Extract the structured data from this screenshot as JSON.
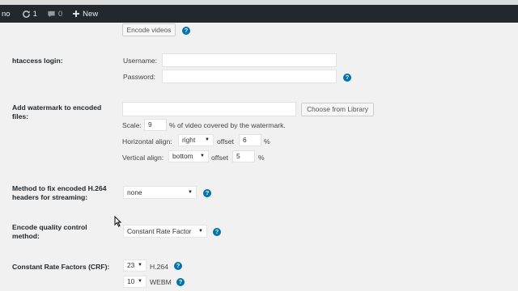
{
  "adminbar": {
    "site_label": "no",
    "updates_count": "1",
    "comments_count": "0",
    "new_label": "New"
  },
  "encode_section": {
    "button_label": "Encode videos"
  },
  "htaccess": {
    "label": "htaccess login:",
    "username_label": "Username:",
    "password_label": "Password:"
  },
  "watermark": {
    "label": "Add watermark to encoded files:",
    "choose_button": "Choose from Library",
    "scale_label": "Scale:",
    "scale_value": "9",
    "scale_suffix": "% of video covered by the watermark.",
    "h_align_label": "Horizontal align:",
    "h_align_value": "right",
    "h_offset_label": "offset",
    "h_offset_value": "6",
    "h_offset_unit": "%",
    "v_align_label": "Vertical align:",
    "v_align_value": "bottom",
    "v_offset_label": "offset",
    "v_offset_value": "5",
    "v_offset_unit": "%"
  },
  "h264_fix": {
    "label": "Method to fix encoded H.264 headers for streaming:",
    "value": "none"
  },
  "quality": {
    "label": "Encode quality control method:",
    "value": "Constant Rate Factor"
  },
  "crf": {
    "label": "Constant Rate Factors (CRF):",
    "h264_value": "23",
    "h264_label": "H.264",
    "webm_value": "10",
    "webm_label": "WEBM"
  },
  "help_glyph": "?",
  "caret_glyph": "▼",
  "colors": {
    "adminbar_bg": "#23282d",
    "page_bg": "#f1f1f1",
    "help_blue": "#0073aa"
  }
}
